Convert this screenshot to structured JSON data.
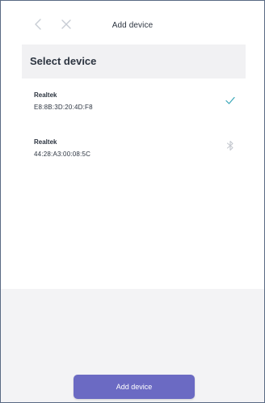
{
  "header": {
    "title": "Add device",
    "back_icon": "chevron-left-icon",
    "close_icon": "close-icon"
  },
  "section": {
    "title": "Select device"
  },
  "devices": [
    {
      "name": "Realtek",
      "mac": "E8:8B:3D:20:4D:F8",
      "status_icon": "check-icon",
      "selected": true
    },
    {
      "name": "Realtek",
      "mac": "44:28:A3:00:08:5C",
      "status_icon": "bluetooth-icon",
      "selected": false
    }
  ],
  "footer": {
    "button_label": "Add device"
  },
  "colors": {
    "accent": "#6b6ac3",
    "check": "#3aa7b8",
    "panel": "#f3f3f5",
    "header_bg": "#f1f1f3"
  }
}
